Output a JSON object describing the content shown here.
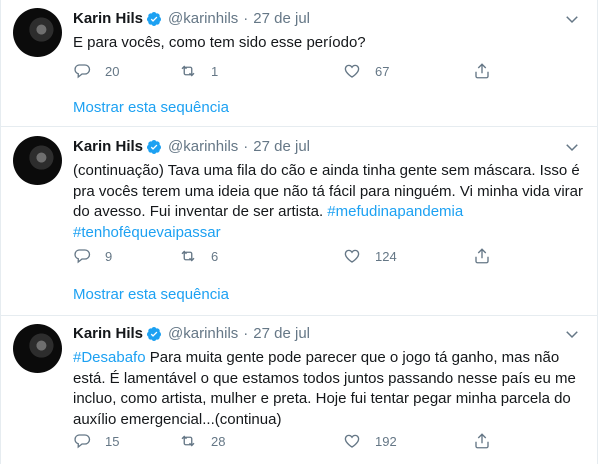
{
  "tweets": [
    {
      "name": "Karin Hils",
      "handle": "@karinhils",
      "separator": "·",
      "date": "27 de jul",
      "text_plain": "E para vocês, como tem sido esse período?",
      "text_tail": "",
      "hashtags_before": "",
      "hashtags_after": "",
      "replies": "20",
      "retweets": "1",
      "likes": "67",
      "thread_link": "Mostrar esta sequência"
    },
    {
      "name": "Karin Hils",
      "handle": "@karinhils",
      "separator": "·",
      "date": "27 de jul",
      "text_plain": "(continuação) Tava uma fila do cão e ainda tinha gente sem máscara. Isso é pra vocês terem uma ideia que não tá fácil para ninguém. Vi minha vida virar do avesso. Fui inventar de ser artista. ",
      "text_tail": "",
      "hashtags_before": "",
      "hashtags_after": "#mefudinapandemia #tenhofêquevaipassar",
      "replies": "9",
      "retweets": "6",
      "likes": "124",
      "thread_link": "Mostrar esta sequência"
    },
    {
      "name": "Karin Hils",
      "handle": "@karinhils",
      "separator": "·",
      "date": "27 de jul",
      "text_plain": "  Para muita gente pode parecer que o jogo tá ganho, mas não está. É lamentável o que estamos todos juntos passando nesse país eu me incluo, como artista, mulher e preta. Hoje fui tentar pegar minha parcela do auxílio emergencial...(continua)",
      "text_tail": "",
      "hashtags_before": "#Desabafo",
      "hashtags_after": "",
      "replies": "15",
      "retweets": "28",
      "likes": "192",
      "thread_link": ""
    }
  ],
  "icons": {
    "verified": "verified-badge-icon",
    "caret": "chevron-down-icon",
    "reply": "reply-icon",
    "retweet": "retweet-icon",
    "like": "heart-icon",
    "share": "share-icon"
  },
  "colors": {
    "accent": "#1da1f2",
    "muted": "#657786",
    "text": "#14171a",
    "divider": "#e6ecf0"
  }
}
